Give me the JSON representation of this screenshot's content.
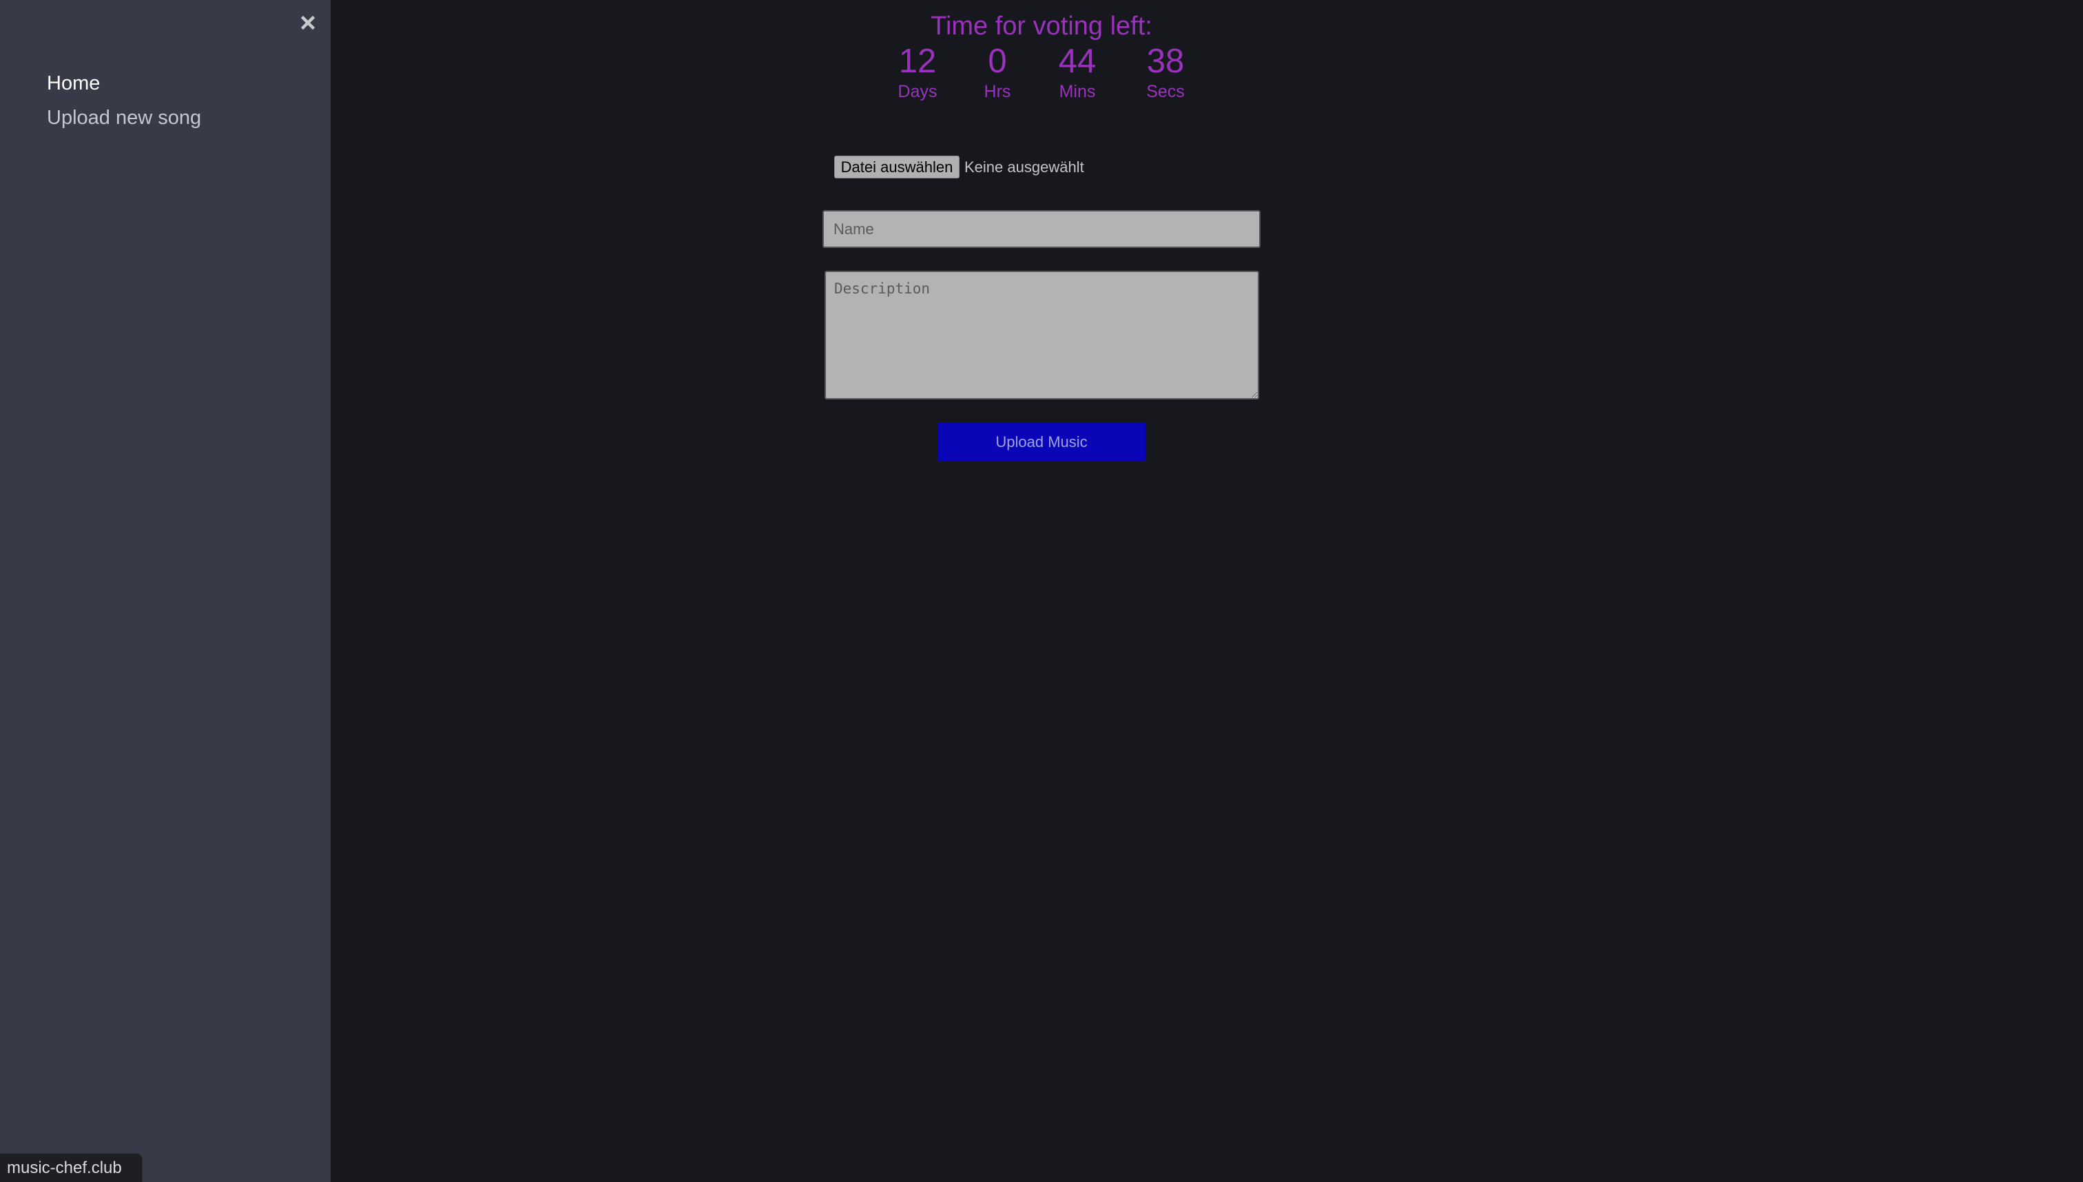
{
  "sidebar": {
    "close_icon": "close-x-icon",
    "items": [
      {
        "label": "Home",
        "active": true
      },
      {
        "label": "Upload new song",
        "active": false
      }
    ]
  },
  "countdown": {
    "title": "Time for voting left:",
    "units": [
      {
        "value": "12",
        "label": "Days"
      },
      {
        "value": "0",
        "label": "Hrs"
      },
      {
        "value": "44",
        "label": "Mins"
      },
      {
        "value": "38",
        "label": "Secs"
      }
    ],
    "color": "#9a32bd"
  },
  "form": {
    "file_button_label": "Datei auswählen",
    "file_status": "Keine ausgewählt",
    "name_placeholder": "Name",
    "name_value": "",
    "description_placeholder": "Description",
    "description_value": "",
    "submit_label": "Upload Music",
    "submit_color": "#0a06b8"
  },
  "status_bar": {
    "url": "music-chef.club"
  },
  "colors": {
    "sidebar_bg": "#383a47",
    "main_bg": "#17181d"
  }
}
